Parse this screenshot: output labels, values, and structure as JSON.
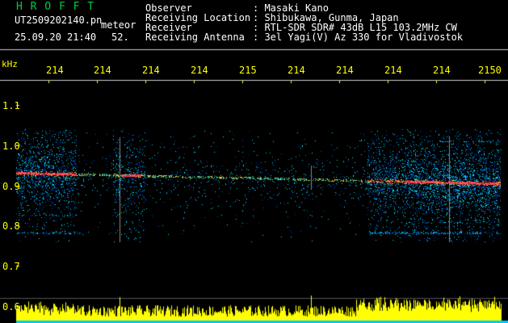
{
  "header": {
    "logo_text": "H R O F F T",
    "filename": "UT2509202140.pn",
    "mode": "meteor",
    "datetime": "25.09.20 21:40",
    "number": "52.",
    "fields": [
      {
        "label": "Observer",
        "value": ": Masaki Kano"
      },
      {
        "label": "Receiving Location",
        "value": ": Shibukawa, Gunma, Japan"
      },
      {
        "label": "Receiver",
        "value": ": RTL-SDR SDR# 43dB L15 103.2MHz CW"
      },
      {
        "label": "Receiving Antenna",
        "value": ": 3el Yagi(V) Az 330 for Vladivostok"
      }
    ]
  },
  "axes": {
    "unit": "kHz",
    "time_ticks": [
      "214",
      "214",
      "214",
      "214",
      "215",
      "214",
      "214",
      "214",
      "214",
      "2150"
    ],
    "freq_ticks": [
      "1.1",
      "1.0",
      "0.9",
      "0.8",
      "0.7",
      "0.6"
    ]
  },
  "colors": {
    "background": "#000000",
    "logo": "#00cc44",
    "header_text": "#ffffff",
    "axis_text": "#ffff00",
    "spectrum_fill": "#ffff00",
    "baseline": "#00ccff"
  }
}
